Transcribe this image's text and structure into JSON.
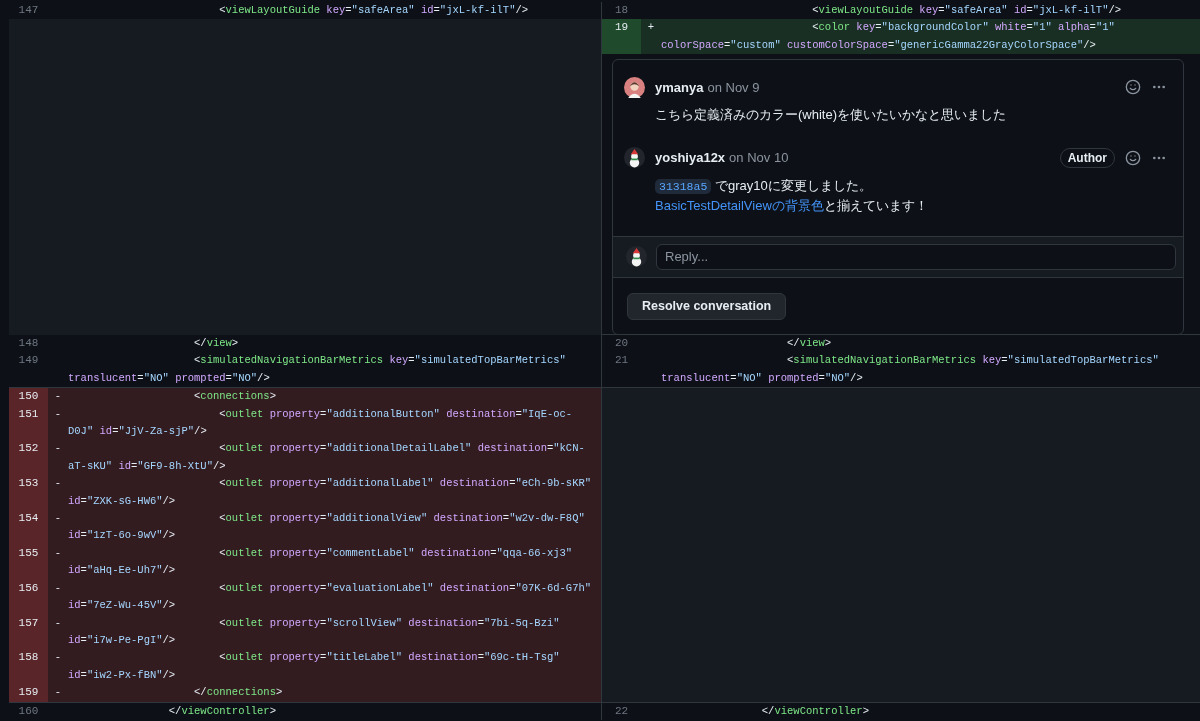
{
  "blocks": [
    {
      "left": [
        {
          "number": "147",
          "kind": "context",
          "code": [
            "                        <viewLayoutGuide key=\"safeArea\" id=\"jxL-kf-ilT\"/>"
          ]
        }
      ],
      "right": [
        {
          "number": "18",
          "kind": "context",
          "code": [
            "                        <viewLayoutGuide key=\"safeArea\" id=\"jxL-kf-ilT\"/>"
          ]
        },
        {
          "number": "19",
          "kind": "added",
          "sign": "+",
          "code": [
            "                        <color key=\"backgroundColor\" white=\"1\" alpha=\"1\"",
            "colorSpace=\"custom\" customColorSpace=\"genericGamma22GrayColorSpace\"/>"
          ]
        }
      ],
      "thread": {
        "comments": [
          {
            "author": "ymanya",
            "date": "on Nov 9",
            "paragraph": [
              [
                {
                  "kind": "text",
                  "text": "こちら定義済みのカラー(white)を使いたいかなと思いました"
                }
              ]
            ]
          },
          {
            "author": "yoshiya12x",
            "date": "on Nov 10",
            "badge": "Author",
            "paragraph": [
              [
                {
                  "kind": "commit",
                  "text": "31318a5"
                },
                {
                  "kind": "text",
                  "text": " でgray10に変更しました。"
                }
              ],
              [
                {
                  "kind": "link",
                  "text": "BasicTestDetailViewの背景色"
                },
                {
                  "kind": "text",
                  "text": "と揃えています！"
                }
              ]
            ]
          }
        ],
        "reply": {
          "placeholder": "Reply..."
        },
        "resolve_button": "Resolve conversation"
      }
    },
    {
      "left": [
        {
          "number": "148",
          "kind": "context",
          "code": [
            "                    </view>"
          ]
        },
        {
          "number": "149",
          "kind": "context",
          "code": [
            "                    <simulatedNavigationBarMetrics key=\"simulatedTopBarMetrics\"",
            "translucent=\"NO\" prompted=\"NO\"/>"
          ]
        }
      ],
      "right": [
        {
          "number": "20",
          "kind": "context",
          "code": [
            "                    </view>"
          ]
        },
        {
          "number": "21",
          "kind": "context",
          "code": [
            "                    <simulatedNavigationBarMetrics key=\"simulatedTopBarMetrics\"",
            "translucent=\"NO\" prompted=\"NO\"/>"
          ]
        }
      ]
    },
    {
      "left": [
        {
          "number": "150",
          "kind": "deleted",
          "sign": "-",
          "code": [
            "                    <connections>"
          ]
        },
        {
          "number": "151",
          "kind": "deleted",
          "sign": "-",
          "code": [
            "                        <outlet property=\"additionalButton\" destination=\"IqE-oc-",
            "D0J\" id=\"JjV-Za-sjP\"/>"
          ]
        },
        {
          "number": "152",
          "kind": "deleted",
          "sign": "-",
          "code": [
            "                        <outlet property=\"additionalDetailLabel\" destination=\"kCN-",
            "aT-sKU\" id=\"GF9-8h-XtU\"/>"
          ]
        },
        {
          "number": "153",
          "kind": "deleted",
          "sign": "-",
          "code": [
            "                        <outlet property=\"additionalLabel\" destination=\"eCh-9b-sKR\"",
            "id=\"ZXK-sG-HW6\"/>"
          ]
        },
        {
          "number": "154",
          "kind": "deleted",
          "sign": "-",
          "code": [
            "                        <outlet property=\"additionalView\" destination=\"w2v-dw-F8Q\"",
            "id=\"1zT-6o-9wV\"/>"
          ]
        },
        {
          "number": "155",
          "kind": "deleted",
          "sign": "-",
          "code": [
            "                        <outlet property=\"commentLabel\" destination=\"qqa-66-xj3\"",
            "id=\"aHq-Ee-Uh7\"/>"
          ]
        },
        {
          "number": "156",
          "kind": "deleted",
          "sign": "-",
          "code": [
            "                        <outlet property=\"evaluationLabel\" destination=\"07K-6d-G7h\"",
            "id=\"7eZ-Wu-45V\"/>"
          ]
        },
        {
          "number": "157",
          "kind": "deleted",
          "sign": "-",
          "code": [
            "                        <outlet property=\"scrollView\" destination=\"7bi-5q-Bzi\"",
            "id=\"i7w-Pe-PgI\"/>"
          ]
        },
        {
          "number": "158",
          "kind": "deleted",
          "sign": "-",
          "code": [
            "                        <outlet property=\"titleLabel\" destination=\"69c-tH-Tsg\"",
            "id=\"iw2-Px-fBN\"/>"
          ]
        },
        {
          "number": "159",
          "kind": "deleted",
          "sign": "-",
          "code": [
            "                    </connections>"
          ]
        }
      ]
    },
    {
      "left": [
        {
          "number": "160",
          "kind": "context",
          "code": [
            "                </viewController>"
          ]
        }
      ],
      "right": [
        {
          "number": "22",
          "kind": "context",
          "code": [
            "                </viewController>"
          ]
        }
      ]
    }
  ]
}
